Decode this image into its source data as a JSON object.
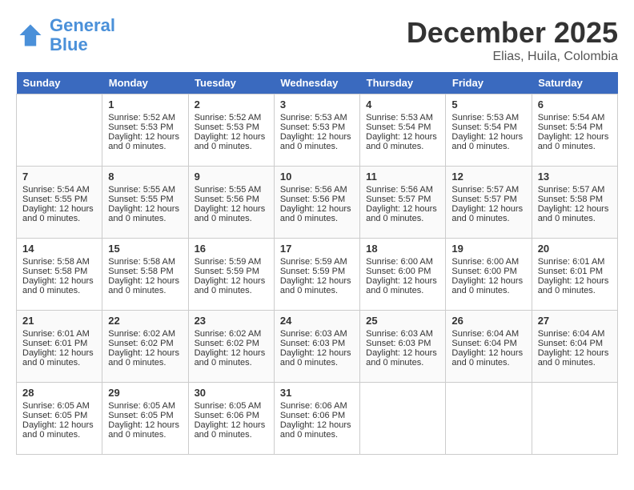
{
  "logo": {
    "text_general": "General",
    "text_blue": "Blue"
  },
  "title": "December 2025",
  "location": "Elias, Huila, Colombia",
  "days_of_week": [
    "Sunday",
    "Monday",
    "Tuesday",
    "Wednesday",
    "Thursday",
    "Friday",
    "Saturday"
  ],
  "weeks": [
    [
      {
        "day": "",
        "sunrise": "",
        "sunset": "",
        "daylight": ""
      },
      {
        "day": "1",
        "sunrise": "Sunrise: 5:52 AM",
        "sunset": "Sunset: 5:53 PM",
        "daylight": "Daylight: 12 hours and 0 minutes."
      },
      {
        "day": "2",
        "sunrise": "Sunrise: 5:52 AM",
        "sunset": "Sunset: 5:53 PM",
        "daylight": "Daylight: 12 hours and 0 minutes."
      },
      {
        "day": "3",
        "sunrise": "Sunrise: 5:53 AM",
        "sunset": "Sunset: 5:53 PM",
        "daylight": "Daylight: 12 hours and 0 minutes."
      },
      {
        "day": "4",
        "sunrise": "Sunrise: 5:53 AM",
        "sunset": "Sunset: 5:54 PM",
        "daylight": "Daylight: 12 hours and 0 minutes."
      },
      {
        "day": "5",
        "sunrise": "Sunrise: 5:53 AM",
        "sunset": "Sunset: 5:54 PM",
        "daylight": "Daylight: 12 hours and 0 minutes."
      },
      {
        "day": "6",
        "sunrise": "Sunrise: 5:54 AM",
        "sunset": "Sunset: 5:54 PM",
        "daylight": "Daylight: 12 hours and 0 minutes."
      }
    ],
    [
      {
        "day": "7",
        "sunrise": "Sunrise: 5:54 AM",
        "sunset": "Sunset: 5:55 PM",
        "daylight": "Daylight: 12 hours and 0 minutes."
      },
      {
        "day": "8",
        "sunrise": "Sunrise: 5:55 AM",
        "sunset": "Sunset: 5:55 PM",
        "daylight": "Daylight: 12 hours and 0 minutes."
      },
      {
        "day": "9",
        "sunrise": "Sunrise: 5:55 AM",
        "sunset": "Sunset: 5:56 PM",
        "daylight": "Daylight: 12 hours and 0 minutes."
      },
      {
        "day": "10",
        "sunrise": "Sunrise: 5:56 AM",
        "sunset": "Sunset: 5:56 PM",
        "daylight": "Daylight: 12 hours and 0 minutes."
      },
      {
        "day": "11",
        "sunrise": "Sunrise: 5:56 AM",
        "sunset": "Sunset: 5:57 PM",
        "daylight": "Daylight: 12 hours and 0 minutes."
      },
      {
        "day": "12",
        "sunrise": "Sunrise: 5:57 AM",
        "sunset": "Sunset: 5:57 PM",
        "daylight": "Daylight: 12 hours and 0 minutes."
      },
      {
        "day": "13",
        "sunrise": "Sunrise: 5:57 AM",
        "sunset": "Sunset: 5:58 PM",
        "daylight": "Daylight: 12 hours and 0 minutes."
      }
    ],
    [
      {
        "day": "14",
        "sunrise": "Sunrise: 5:58 AM",
        "sunset": "Sunset: 5:58 PM",
        "daylight": "Daylight: 12 hours and 0 minutes."
      },
      {
        "day": "15",
        "sunrise": "Sunrise: 5:58 AM",
        "sunset": "Sunset: 5:58 PM",
        "daylight": "Daylight: 12 hours and 0 minutes."
      },
      {
        "day": "16",
        "sunrise": "Sunrise: 5:59 AM",
        "sunset": "Sunset: 5:59 PM",
        "daylight": "Daylight: 12 hours and 0 minutes."
      },
      {
        "day": "17",
        "sunrise": "Sunrise: 5:59 AM",
        "sunset": "Sunset: 5:59 PM",
        "daylight": "Daylight: 12 hours and 0 minutes."
      },
      {
        "day": "18",
        "sunrise": "Sunrise: 6:00 AM",
        "sunset": "Sunset: 6:00 PM",
        "daylight": "Daylight: 12 hours and 0 minutes."
      },
      {
        "day": "19",
        "sunrise": "Sunrise: 6:00 AM",
        "sunset": "Sunset: 6:00 PM",
        "daylight": "Daylight: 12 hours and 0 minutes."
      },
      {
        "day": "20",
        "sunrise": "Sunrise: 6:01 AM",
        "sunset": "Sunset: 6:01 PM",
        "daylight": "Daylight: 12 hours and 0 minutes."
      }
    ],
    [
      {
        "day": "21",
        "sunrise": "Sunrise: 6:01 AM",
        "sunset": "Sunset: 6:01 PM",
        "daylight": "Daylight: 12 hours and 0 minutes."
      },
      {
        "day": "22",
        "sunrise": "Sunrise: 6:02 AM",
        "sunset": "Sunset: 6:02 PM",
        "daylight": "Daylight: 12 hours and 0 minutes."
      },
      {
        "day": "23",
        "sunrise": "Sunrise: 6:02 AM",
        "sunset": "Sunset: 6:02 PM",
        "daylight": "Daylight: 12 hours and 0 minutes."
      },
      {
        "day": "24",
        "sunrise": "Sunrise: 6:03 AM",
        "sunset": "Sunset: 6:03 PM",
        "daylight": "Daylight: 12 hours and 0 minutes."
      },
      {
        "day": "25",
        "sunrise": "Sunrise: 6:03 AM",
        "sunset": "Sunset: 6:03 PM",
        "daylight": "Daylight: 12 hours and 0 minutes."
      },
      {
        "day": "26",
        "sunrise": "Sunrise: 6:04 AM",
        "sunset": "Sunset: 6:04 PM",
        "daylight": "Daylight: 12 hours and 0 minutes."
      },
      {
        "day": "27",
        "sunrise": "Sunrise: 6:04 AM",
        "sunset": "Sunset: 6:04 PM",
        "daylight": "Daylight: 12 hours and 0 minutes."
      }
    ],
    [
      {
        "day": "28",
        "sunrise": "Sunrise: 6:05 AM",
        "sunset": "Sunset: 6:05 PM",
        "daylight": "Daylight: 12 hours and 0 minutes."
      },
      {
        "day": "29",
        "sunrise": "Sunrise: 6:05 AM",
        "sunset": "Sunset: 6:05 PM",
        "daylight": "Daylight: 12 hours and 0 minutes."
      },
      {
        "day": "30",
        "sunrise": "Sunrise: 6:05 AM",
        "sunset": "Sunset: 6:06 PM",
        "daylight": "Daylight: 12 hours and 0 minutes."
      },
      {
        "day": "31",
        "sunrise": "Sunrise: 6:06 AM",
        "sunset": "Sunset: 6:06 PM",
        "daylight": "Daylight: 12 hours and 0 minutes."
      },
      {
        "day": "",
        "sunrise": "",
        "sunset": "",
        "daylight": ""
      },
      {
        "day": "",
        "sunrise": "",
        "sunset": "",
        "daylight": ""
      },
      {
        "day": "",
        "sunrise": "",
        "sunset": "",
        "daylight": ""
      }
    ]
  ]
}
